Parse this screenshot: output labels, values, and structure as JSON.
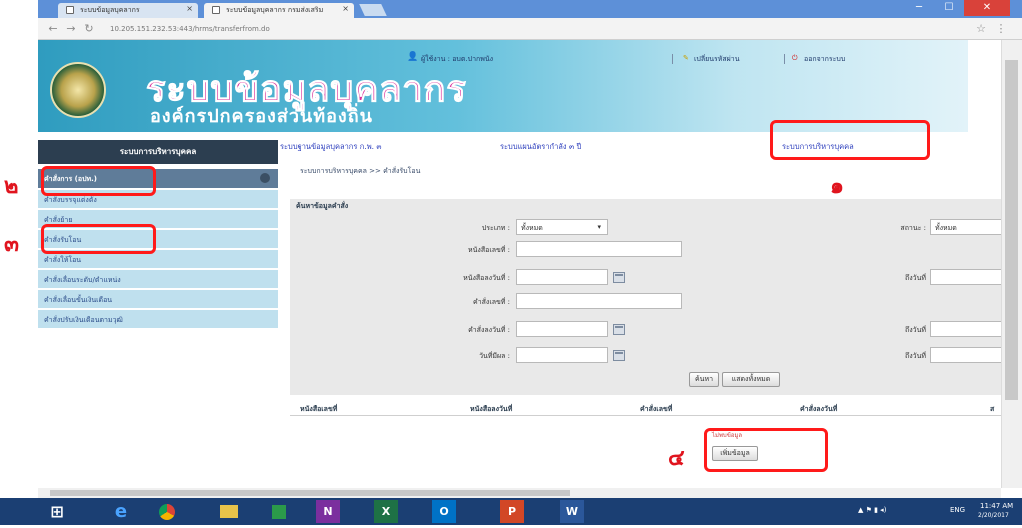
{
  "browser": {
    "tabs": [
      {
        "label": "ระบบข้อมูลบุคลากร"
      },
      {
        "label": "ระบบข้อมูลบุคลากร กรมส่งเสริม"
      }
    ],
    "url": "10.205.151.232.53:443/hrms/transferfrom.do",
    "window_controls": [
      "─",
      "☐",
      "✕"
    ]
  },
  "header": {
    "title": "ระบบข้อมูลบุคลากร",
    "subtitle": "องค์กรปกครองส่วนท้องถิ่น",
    "user_info": "ผู้ใช้งาน : อบต.ปากพนัง",
    "change_password": "เปลี่ยนรหัสผ่าน",
    "logout": "ออกจากระบบ"
  },
  "topnav": {
    "items": [
      "ระบบฐานข้อมูลบุคลากร ก.พ. ๓",
      "ระบบแผนอัตรากำลัง ๓ ปี",
      "ระบบการบริหารบุคคล"
    ]
  },
  "sidebar": {
    "heading": "ระบบการบริหารบุคคล",
    "items": [
      {
        "label": "คำสั่งการ (อปท.)"
      },
      {
        "label": "คำสั่งบรรจุแต่งตั้ง"
      },
      {
        "label": "คำสั่งย้าย"
      },
      {
        "label": "คำสั่งรับโอน"
      },
      {
        "label": "คำสั่งให้โอน"
      },
      {
        "label": "คำสั่งเลื่อนระดับ/ตำแหน่ง"
      },
      {
        "label": "คำสั่งเลื่อนขั้นเงินเดือน"
      },
      {
        "label": "คำสั่งปรับเงินเดือนตามวุฒิ"
      }
    ]
  },
  "breadcrumb": "ระบบการบริหารบุคคล >> คำสั่งรับโอน",
  "search": {
    "section_title": "ค้นหาข้อมูลคำสั่ง",
    "labels": {
      "type": "ประเภท :",
      "status": "สถานะ :",
      "book_no": "หนังสือเลขที่ :",
      "book_date": "หนังสือลงวันที่ :",
      "order_no": "คำสั่งเลขที่ :",
      "order_date": "คำสั่งลงวันที่ :",
      "effective_date": "วันที่มีผล :",
      "to_date": "ถึงวันที่"
    },
    "type_value": "ทั้งหมด",
    "status_value": "ทั้งหมด",
    "search_button": "ค้นหา",
    "show_all_button": "แสดงทั้งหมด"
  },
  "table": {
    "columns": [
      "หนังสือเลขที่",
      "หนังสือลงวันที่",
      "คำสั่งเลขที่",
      "คำสั่งลงวันที่",
      "ส"
    ]
  },
  "nodata": "ไม่พบข้อมูล",
  "add_button": "เพิ่มข้อมูล",
  "annotations": [
    "๑",
    "๒",
    "๓",
    "๔"
  ],
  "taskbar": {
    "time": "11:47 AM",
    "date": "2/20/2017",
    "lang": "ENG",
    "apps": [
      "N",
      "X",
      "O",
      "P",
      "W"
    ]
  },
  "colors": {
    "annotation_red": "#ff1a1a",
    "brand_pink": "#d92f9a",
    "sidebar_dark": "#2c3e50",
    "taskbar": "#1b3f73"
  }
}
